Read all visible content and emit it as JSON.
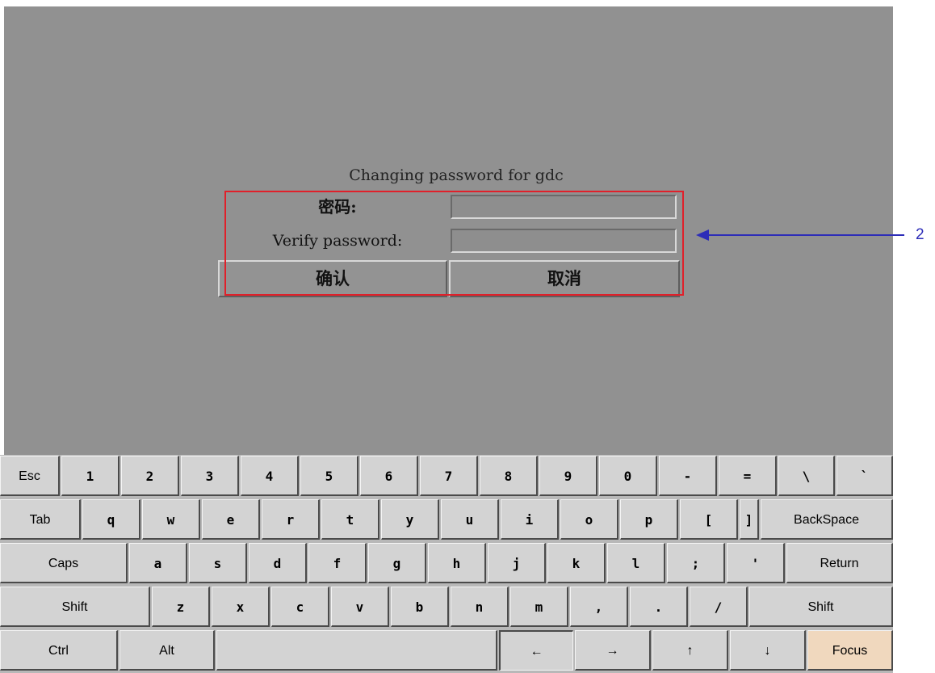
{
  "dialog": {
    "title": "Changing password for gdc",
    "password_label": "密码:",
    "verify_label": "Verify password:",
    "password_value": "",
    "verify_value": "",
    "confirm_label": "确认",
    "cancel_label": "取消"
  },
  "callout": {
    "number": "2",
    "color": "#2d2db8",
    "highlight_color": "#e0202a"
  },
  "keyboard": {
    "row1": [
      "Esc",
      "1",
      "2",
      "3",
      "4",
      "5",
      "6",
      "7",
      "8",
      "9",
      "0",
      "-",
      "=",
      "\\",
      "`"
    ],
    "row2": [
      "Tab",
      "q",
      "w",
      "e",
      "r",
      "t",
      "y",
      "u",
      "i",
      "o",
      "p",
      "[",
      "]",
      "BackSpace"
    ],
    "row3": [
      "Caps",
      "a",
      "s",
      "d",
      "f",
      "g",
      "h",
      "j",
      "k",
      "l",
      ";",
      "'",
      "Return"
    ],
    "row4": [
      "Shift",
      "z",
      "x",
      "c",
      "v",
      "b",
      "n",
      "m",
      ",",
      ".",
      "/",
      "Shift"
    ],
    "row5": [
      "Ctrl",
      "Alt",
      "",
      "←",
      "→",
      "↑",
      "↓",
      "Focus"
    ]
  }
}
